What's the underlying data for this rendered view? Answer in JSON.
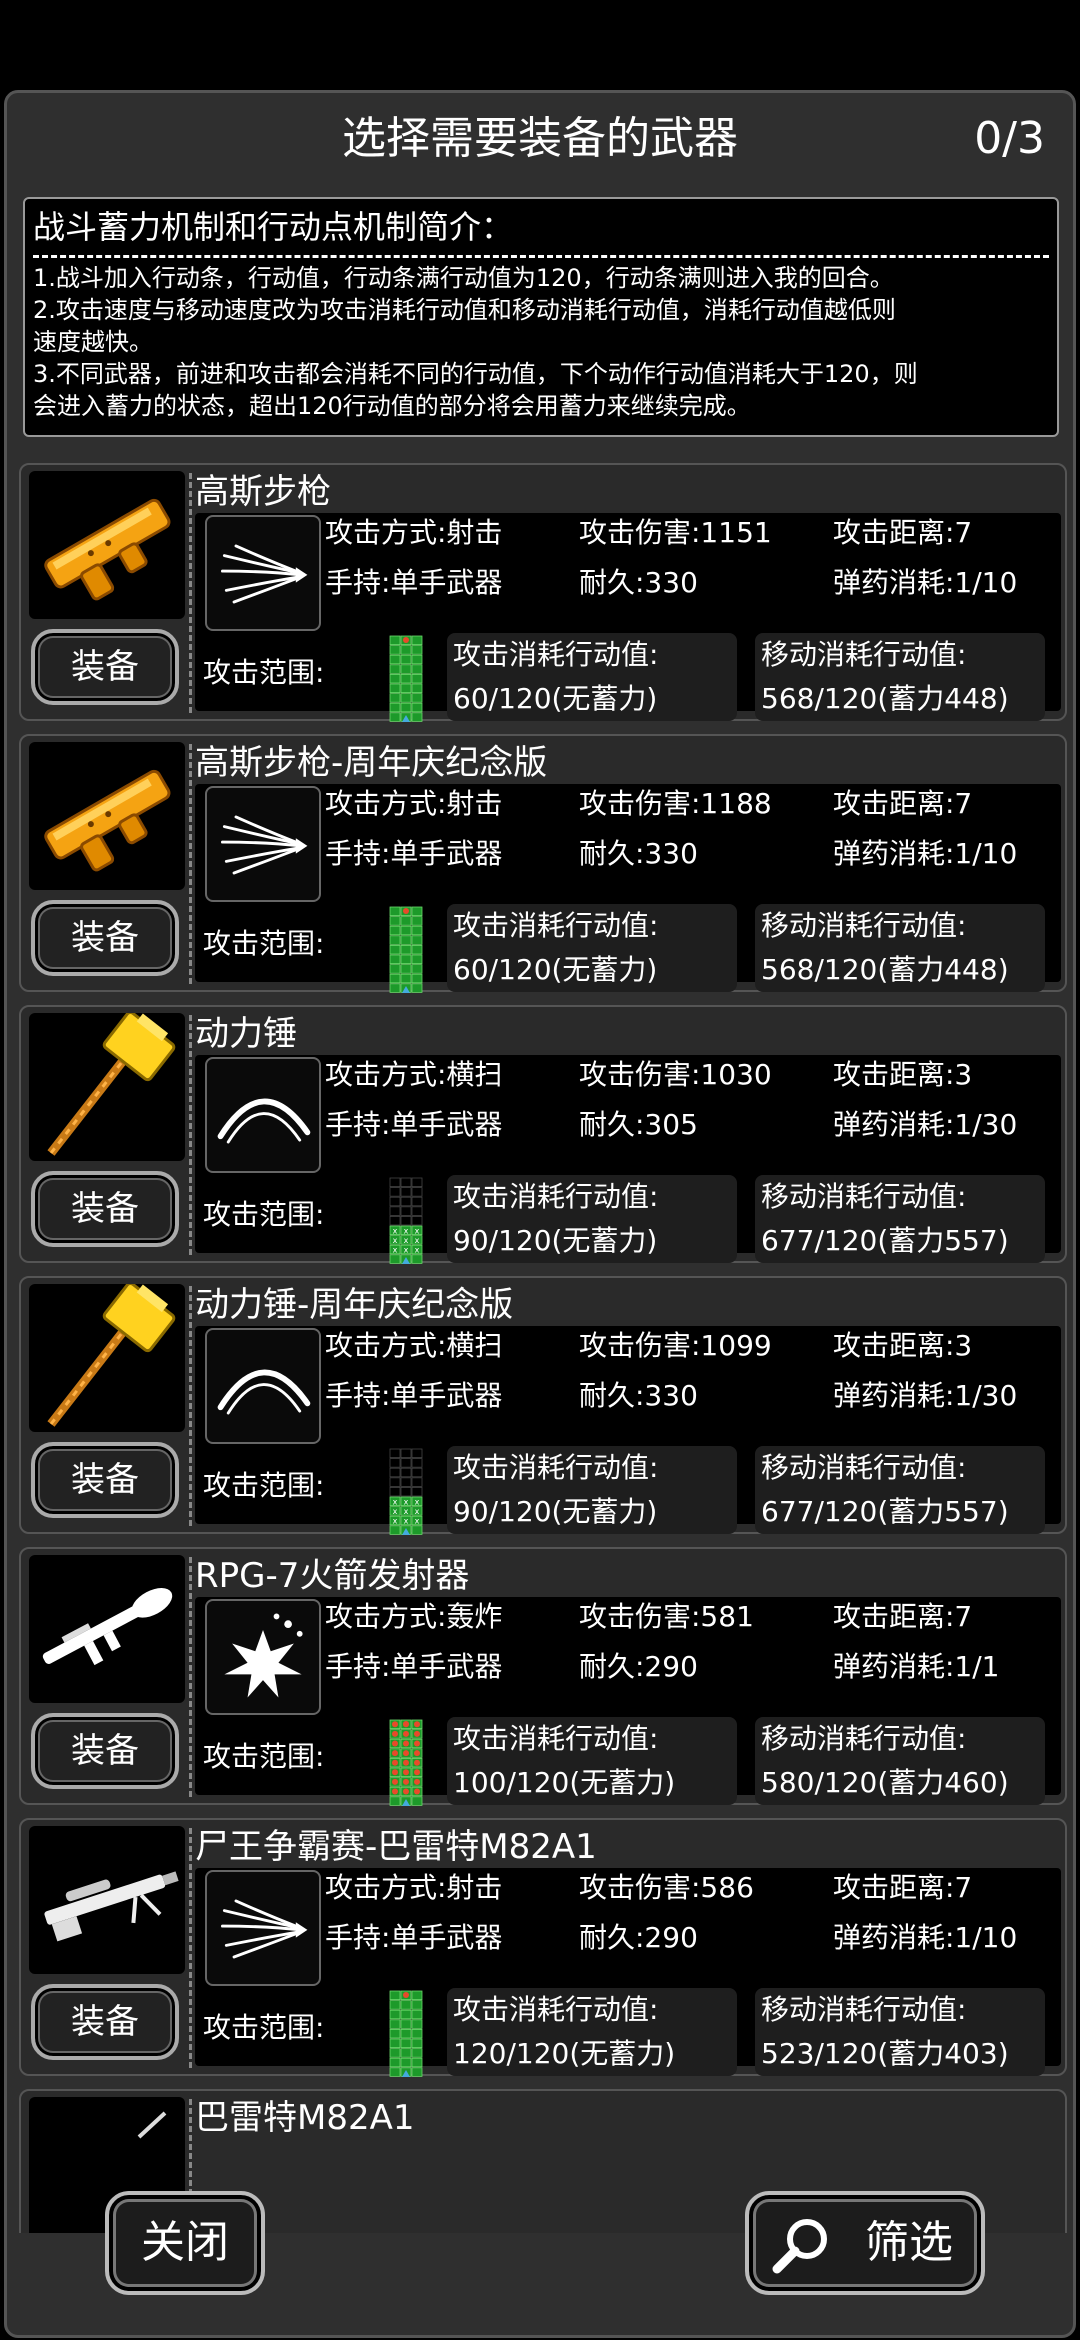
{
  "header": {
    "title": "选择需要装备的武器",
    "counter": "0/3"
  },
  "intro": {
    "title": "战斗蓄力机制和行动点机制简介：",
    "lines": [
      "1.战斗加入行动条，行动值，行动条满行动值为120，行动条满则进入我的回合。",
      "2.攻击速度与移动速度改为攻击消耗行动值和移动消耗行动值，消耗行动值越低则",
      "速度越快。",
      "3.不同武器，前进和攻击都会消耗不同的行动值，下个动作行动值消耗大于120，则",
      "会进入蓄力的状态，超出120行动值的部分将会用蓄力来继续完成。"
    ]
  },
  "labels": {
    "equip": "装备",
    "range": "攻击范围:",
    "atk_cost": "攻击消耗行动值:",
    "move_cost": "移动消耗行动值:"
  },
  "weapons": [
    {
      "name": "高斯步枪",
      "mode": "攻击方式:射击",
      "dmg": "攻击伤害:1151",
      "dist": "攻击距离:7",
      "hold": "手持:单手武器",
      "dur": "耐久:330",
      "ammo": "弹药消耗:1/10",
      "atk": "60/120(无蓄力)",
      "move": "568/120(蓄力448)"
    },
    {
      "name": "高斯步枪-周年庆纪念版",
      "mode": "攻击方式:射击",
      "dmg": "攻击伤害:1188",
      "dist": "攻击距离:7",
      "hold": "手持:单手武器",
      "dur": "耐久:330",
      "ammo": "弹药消耗:1/10",
      "atk": "60/120(无蓄力)",
      "move": "568/120(蓄力448)"
    },
    {
      "name": "动力锤",
      "mode": "攻击方式:横扫",
      "dmg": "攻击伤害:1030",
      "dist": "攻击距离:3",
      "hold": "手持:单手武器",
      "dur": "耐久:305",
      "ammo": "弹药消耗:1/30",
      "atk": "90/120(无蓄力)",
      "move": "677/120(蓄力557)"
    },
    {
      "name": "动力锤-周年庆纪念版",
      "mode": "攻击方式:横扫",
      "dmg": "攻击伤害:1099",
      "dist": "攻击距离:3",
      "hold": "手持:单手武器",
      "dur": "耐久:330",
      "ammo": "弹药消耗:1/30",
      "atk": "90/120(无蓄力)",
      "move": "677/120(蓄力557)"
    },
    {
      "name": "RPG-7火箭发射器",
      "mode": "攻击方式:轰炸",
      "dmg": "攻击伤害:581",
      "dist": "攻击距离:7",
      "hold": "手持:单手武器",
      "dur": "耐久:290",
      "ammo": "弹药消耗:1/1",
      "atk": "100/120(无蓄力)",
      "move": "580/120(蓄力460)"
    },
    {
      "name": "尸王争霸赛-巴雷特M82A1",
      "mode": "攻击方式:射击",
      "dmg": "攻击伤害:586",
      "dist": "攻击距离:7",
      "hold": "手持:单手武器",
      "dur": "耐久:290",
      "ammo": "弹药消耗:1/10",
      "atk": "120/120(无蓄力)",
      "move": "523/120(蓄力403)"
    },
    {
      "name": "巴雷特M82A1"
    }
  ],
  "footer": {
    "close": "关闭",
    "filter": "筛选"
  }
}
